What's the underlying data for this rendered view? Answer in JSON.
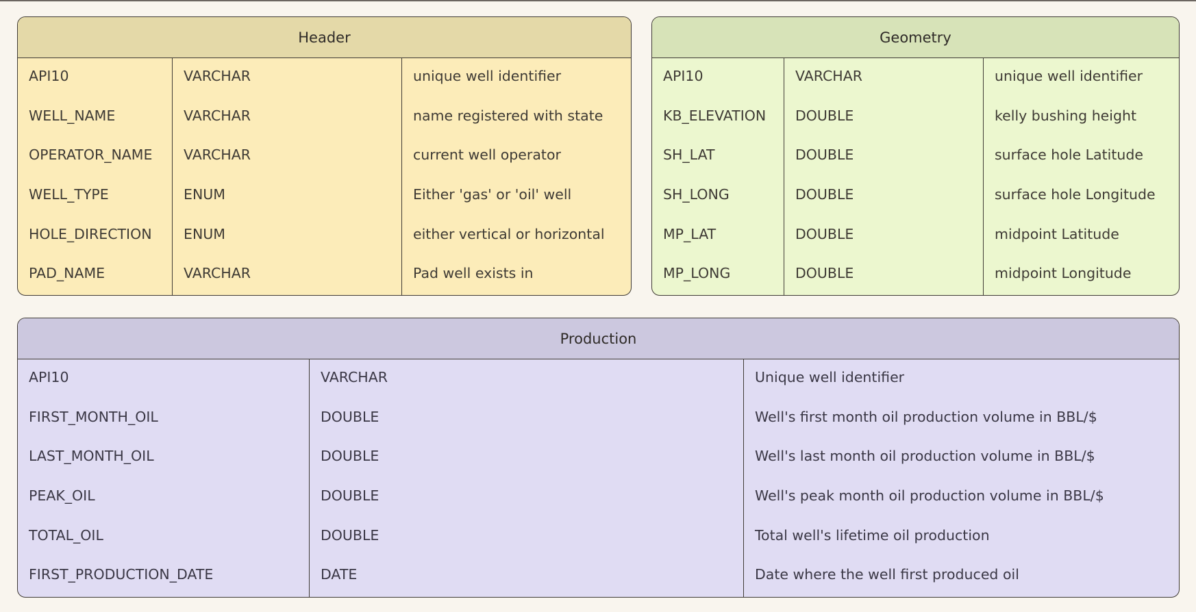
{
  "tables": {
    "header": {
      "title": "Header",
      "rows": [
        {
          "name": "API10",
          "type": "VARCHAR",
          "description": "unique well identifier"
        },
        {
          "name": "WELL_NAME",
          "type": "VARCHAR",
          "description": "name registered with state"
        },
        {
          "name": "OPERATOR_NAME",
          "type": "VARCHAR",
          "description": "current well operator"
        },
        {
          "name": "WELL_TYPE",
          "type": "ENUM",
          "description": "Either 'gas' or 'oil' well"
        },
        {
          "name": "HOLE_DIRECTION",
          "type": "ENUM",
          "description": "either vertical or horizontal"
        },
        {
          "name": "PAD_NAME",
          "type": "VARCHAR",
          "description": "Pad well exists in"
        }
      ]
    },
    "geometry": {
      "title": "Geometry",
      "rows": [
        {
          "name": "API10",
          "type": "VARCHAR",
          "description": "unique well identifier"
        },
        {
          "name": "KB_ELEVATION",
          "type": "DOUBLE",
          "description": "kelly bushing height"
        },
        {
          "name": "SH_LAT",
          "type": "DOUBLE",
          "description": "surface hole Latitude"
        },
        {
          "name": "SH_LONG",
          "type": "DOUBLE",
          "description": "surface hole Longitude"
        },
        {
          "name": "MP_LAT",
          "type": "DOUBLE",
          "description": "midpoint Latitude"
        },
        {
          "name": "MP_LONG",
          "type": "DOUBLE",
          "description": "midpoint Longitude"
        }
      ]
    },
    "production": {
      "title": "Production",
      "rows": [
        {
          "name": "API10",
          "type": "VARCHAR",
          "description": "Unique well identifier"
        },
        {
          "name": "FIRST_MONTH_OIL",
          "type": "DOUBLE",
          "description": "Well's first month oil production volume in BBL/$"
        },
        {
          "name": "LAST_MONTH_OIL",
          "type": "DOUBLE",
          "description": "Well's last month oil production volume in BBL/$"
        },
        {
          "name": "PEAK_OIL",
          "type": "DOUBLE",
          "description": "Well's peak month oil production volume in BBL/$"
        },
        {
          "name": "TOTAL_OIL",
          "type": "DOUBLE",
          "description": "Total well's lifetime oil production"
        },
        {
          "name": "FIRST_PRODUCTION_DATE",
          "type": "DATE",
          "description": "Date where the well first produced oil"
        }
      ]
    }
  },
  "colors": {
    "background": "#f9f5ee",
    "header_table_fill": "#fcecb9",
    "header_table_title": "#e4d9a8",
    "geometry_table_fill": "#ecf7cf",
    "geometry_table_title": "#d7e3b8",
    "production_table_fill": "#e0dcf3",
    "production_table_title": "#ccc8df",
    "border": "#3f3a35"
  }
}
